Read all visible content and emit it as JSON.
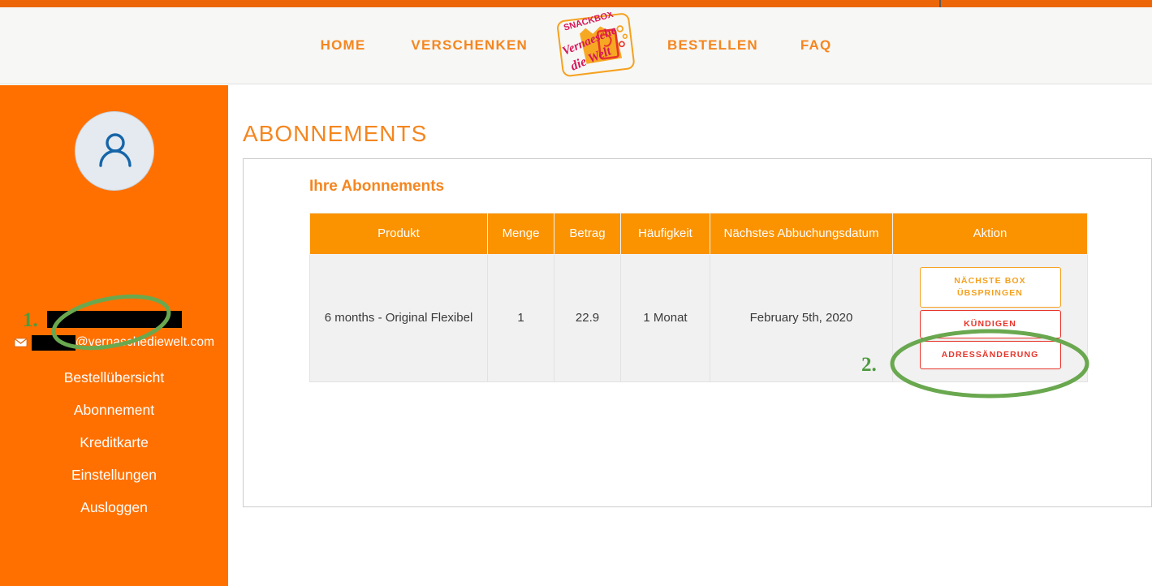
{
  "theme": {
    "brand_orange": "#ec6608",
    "sidebar_orange": "#ff7000",
    "nav_orange": "#f5861f",
    "table_header_orange": "#fb9200",
    "danger_red": "#e8342a",
    "annotation_green": "#4e9a3e"
  },
  "header": {
    "nav_items": [
      {
        "label": "HOME",
        "name": "nav-home"
      },
      {
        "label": "VERSCHENKEN",
        "name": "nav-verschenken"
      },
      {
        "label": "BESTELLEN",
        "name": "nav-bestellen"
      },
      {
        "label": "FAQ",
        "name": "nav-faq"
      }
    ],
    "logo": {
      "top_text": "SNACKBOX",
      "script_line1": "Vernaesche",
      "script_line2": "die Welt"
    }
  },
  "sidebar": {
    "avatar_icon": "user-avatar-icon",
    "user_name": "",
    "user_name_redacted": true,
    "email_icon": "envelope-icon",
    "email_local_redacted": true,
    "email_domain": "@vernaschediewelt.com",
    "items": [
      {
        "label": "Bestellübersicht",
        "name": "sidebar-item-bestelluebersicht"
      },
      {
        "label": "Abonnement",
        "name": "sidebar-item-abonnement"
      },
      {
        "label": "Kreditkarte",
        "name": "sidebar-item-kreditkarte"
      },
      {
        "label": "Einstellungen",
        "name": "sidebar-item-einstellungen"
      },
      {
        "label": "Ausloggen",
        "name": "sidebar-item-ausloggen"
      }
    ]
  },
  "main": {
    "page_title": "ABONNEMENTS",
    "panel_title": "Ihre Abonnements",
    "table": {
      "columns": [
        "Produkt",
        "Menge",
        "Betrag",
        "Häufigkeit",
        "Nächstes Abbuchungsdatum",
        "Aktion"
      ],
      "rows": [
        {
          "produkt": "6 months - Original Flexibel",
          "menge": "1",
          "betrag": "22.9",
          "haeufigkeit": "1 Monat",
          "naechstes_abbuchungsdatum": "February 5th, 2020",
          "actions": [
            {
              "label": "NÄCHSTE BOX ÜBSPRINGEN",
              "style": "skip",
              "name": "skip-next-box-button"
            },
            {
              "label": "KÜNDIGEN",
              "style": "cancel",
              "name": "cancel-subscription-button"
            },
            {
              "label": "ADRESSÄNDERUNG",
              "style": "address",
              "name": "change-address-button"
            }
          ]
        }
      ]
    }
  },
  "annotations": {
    "marker_1": "1.",
    "marker_2": "2."
  }
}
